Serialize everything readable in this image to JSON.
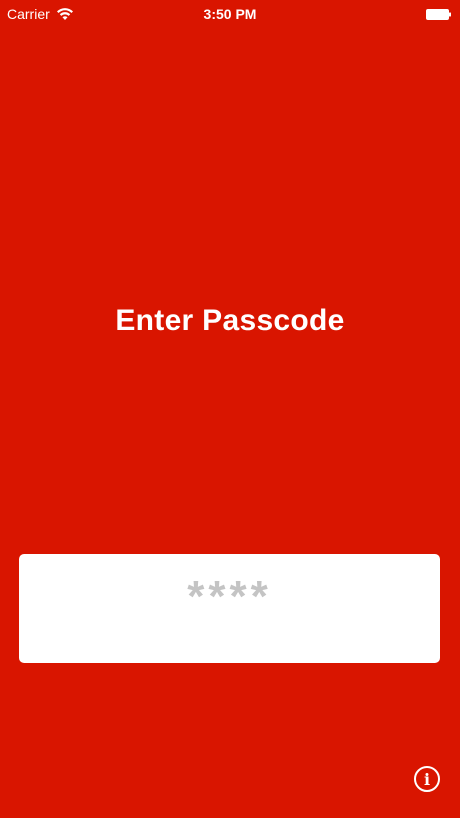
{
  "status_bar": {
    "carrier": "Carrier",
    "time": "3:50 PM",
    "wifi_icon": "wifi-icon",
    "battery_icon": "battery-icon"
  },
  "title": "Enter Passcode",
  "passcode": {
    "placeholder": "****",
    "value": ""
  },
  "info_button": {
    "icon": "info-icon",
    "glyph": "i"
  },
  "colors": {
    "background": "#d91500",
    "text": "#ffffff",
    "placeholder": "#c4c4c4"
  }
}
